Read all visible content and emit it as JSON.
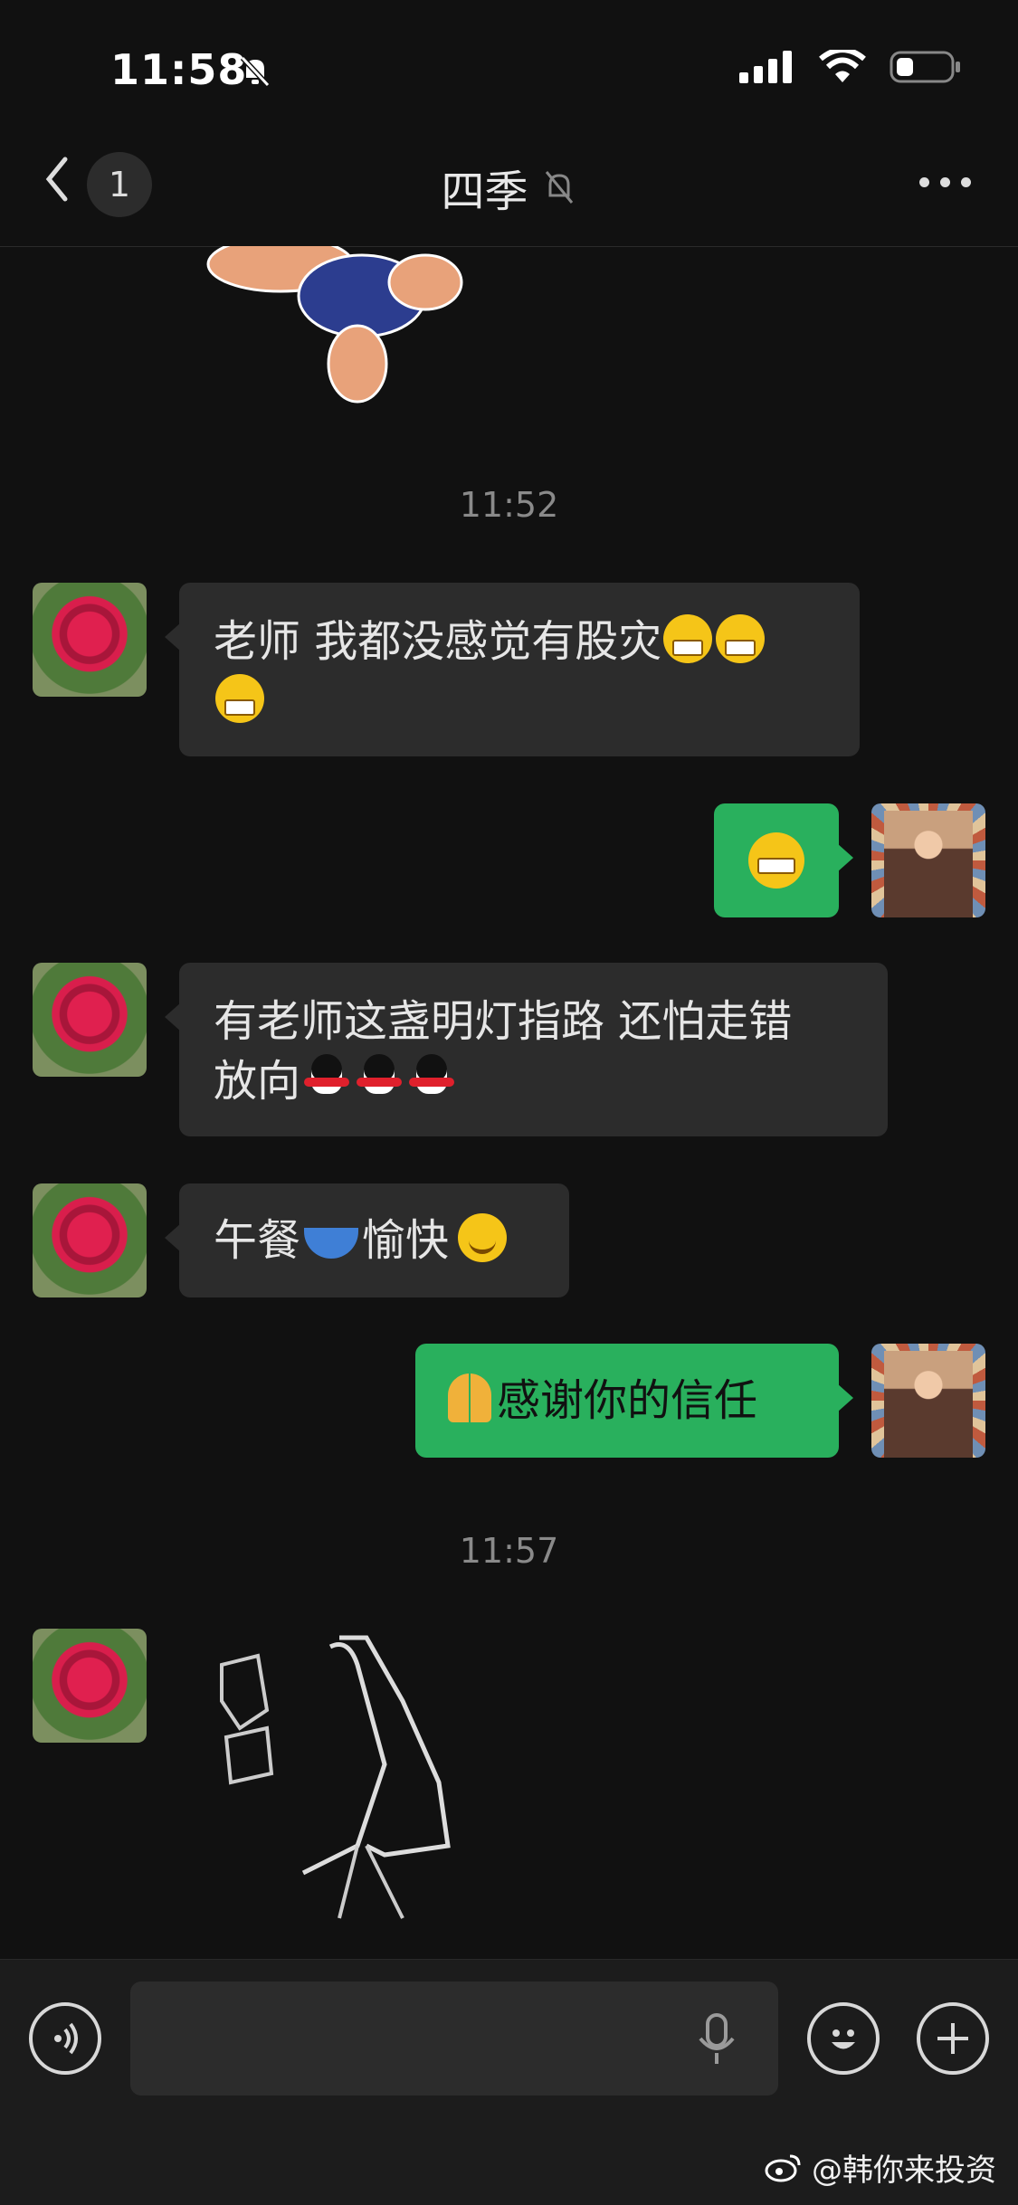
{
  "status_bar": {
    "time": "11:58",
    "icons": [
      "bell-slash-icon",
      "signal-icon",
      "wifi-icon",
      "battery-icon"
    ]
  },
  "nav": {
    "unread_count": "1",
    "title": "四季",
    "icons": [
      "back-arrow-icon",
      "bell-slash-icon",
      "more-icon"
    ]
  },
  "timestamps": {
    "first": "11:52",
    "second": "11:57"
  },
  "messages": [
    {
      "from": "other",
      "text": "老师 我都没感觉有股灾",
      "emojis": [
        "grin",
        "grin",
        "grin"
      ]
    },
    {
      "from": "me",
      "emoji": "laughing-crying"
    },
    {
      "from": "other",
      "text": "有老师这盏明灯指路 还怕走错放向",
      "line1": "有老师这盏明灯指路 还怕走错",
      "line2": "放向",
      "emojis": [
        "penguin",
        "penguin",
        "penguin"
      ]
    },
    {
      "from": "other",
      "text_a": "午餐",
      "text_b": "愉快",
      "emojis": [
        "bowl",
        "smile"
      ]
    },
    {
      "from": "me",
      "text": "感谢你的信任",
      "emojis": [
        "pray"
      ]
    },
    {
      "from": "other",
      "sticker": "praying-hands-sticker"
    }
  ],
  "input_bar": {
    "icons": [
      "voice-icon",
      "mic-icon",
      "emoji-icon",
      "plus-icon"
    ]
  },
  "watermark": {
    "text": "@韩你来投资",
    "icon": "weibo-icon"
  },
  "colors": {
    "background": "#111111",
    "bubble_in": "#2c2c2c",
    "bubble_out": "#29b05d"
  }
}
